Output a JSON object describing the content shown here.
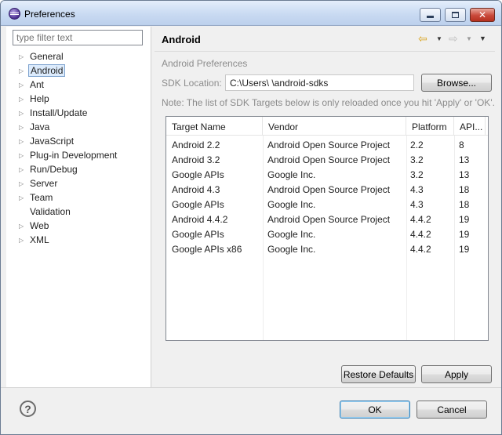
{
  "window": {
    "title": "Preferences"
  },
  "left": {
    "filter_placeholder": "type filter text",
    "items": [
      {
        "label": "General",
        "expandable": true
      },
      {
        "label": "Android",
        "expandable": true,
        "selected": true
      },
      {
        "label": "Ant",
        "expandable": true
      },
      {
        "label": "Help",
        "expandable": true
      },
      {
        "label": "Install/Update",
        "expandable": true
      },
      {
        "label": "Java",
        "expandable": true
      },
      {
        "label": "JavaScript",
        "expandable": true
      },
      {
        "label": "Plug-in Development",
        "expandable": true
      },
      {
        "label": "Run/Debug",
        "expandable": true
      },
      {
        "label": "Server",
        "expandable": true
      },
      {
        "label": "Team",
        "expandable": true
      },
      {
        "label": "Validation",
        "expandable": false
      },
      {
        "label": "Web",
        "expandable": true
      },
      {
        "label": "XML",
        "expandable": true
      }
    ]
  },
  "page": {
    "title": "Android",
    "section_title": "Android Preferences",
    "sdk_label": "SDK Location:",
    "sdk_path": "C:\\Users\\                              \\android-sdks",
    "browse_label": "Browse...",
    "note": "Note: The list of SDK Targets below is only reloaded once you hit 'Apply' or 'OK'."
  },
  "table": {
    "columns": [
      "Target Name",
      "Vendor",
      "Platform",
      "API..."
    ],
    "rows": [
      [
        "Android 2.2",
        "Android Open Source Project",
        "2.2",
        "8"
      ],
      [
        "Android 3.2",
        "Android Open Source Project",
        "3.2",
        "13"
      ],
      [
        "Google APIs",
        "Google Inc.",
        "3.2",
        "13"
      ],
      [
        "Android 4.3",
        "Android Open Source Project",
        "4.3",
        "18"
      ],
      [
        "Google APIs",
        "Google Inc.",
        "4.3",
        "18"
      ],
      [
        "Android 4.4.2",
        "Android Open Source Project",
        "4.4.2",
        "19"
      ],
      [
        "Google APIs",
        "Google Inc.",
        "4.4.2",
        "19"
      ],
      [
        "Google APIs x86",
        "Google Inc.",
        "4.4.2",
        "19"
      ]
    ]
  },
  "buttons": {
    "restore_defaults": "Restore Defaults",
    "apply": "Apply",
    "ok": "OK",
    "cancel": "Cancel",
    "help": "?"
  },
  "icons": {
    "app": "eclipse-icon",
    "back": "back-arrow-icon",
    "forward": "forward-arrow-icon",
    "view_menu": "view-menu-icon",
    "help": "help-icon"
  },
  "colors": {
    "selection_bg": "#dcebfc",
    "selection_border": "#7da2ce",
    "back_arrow": "#d9a21a"
  }
}
